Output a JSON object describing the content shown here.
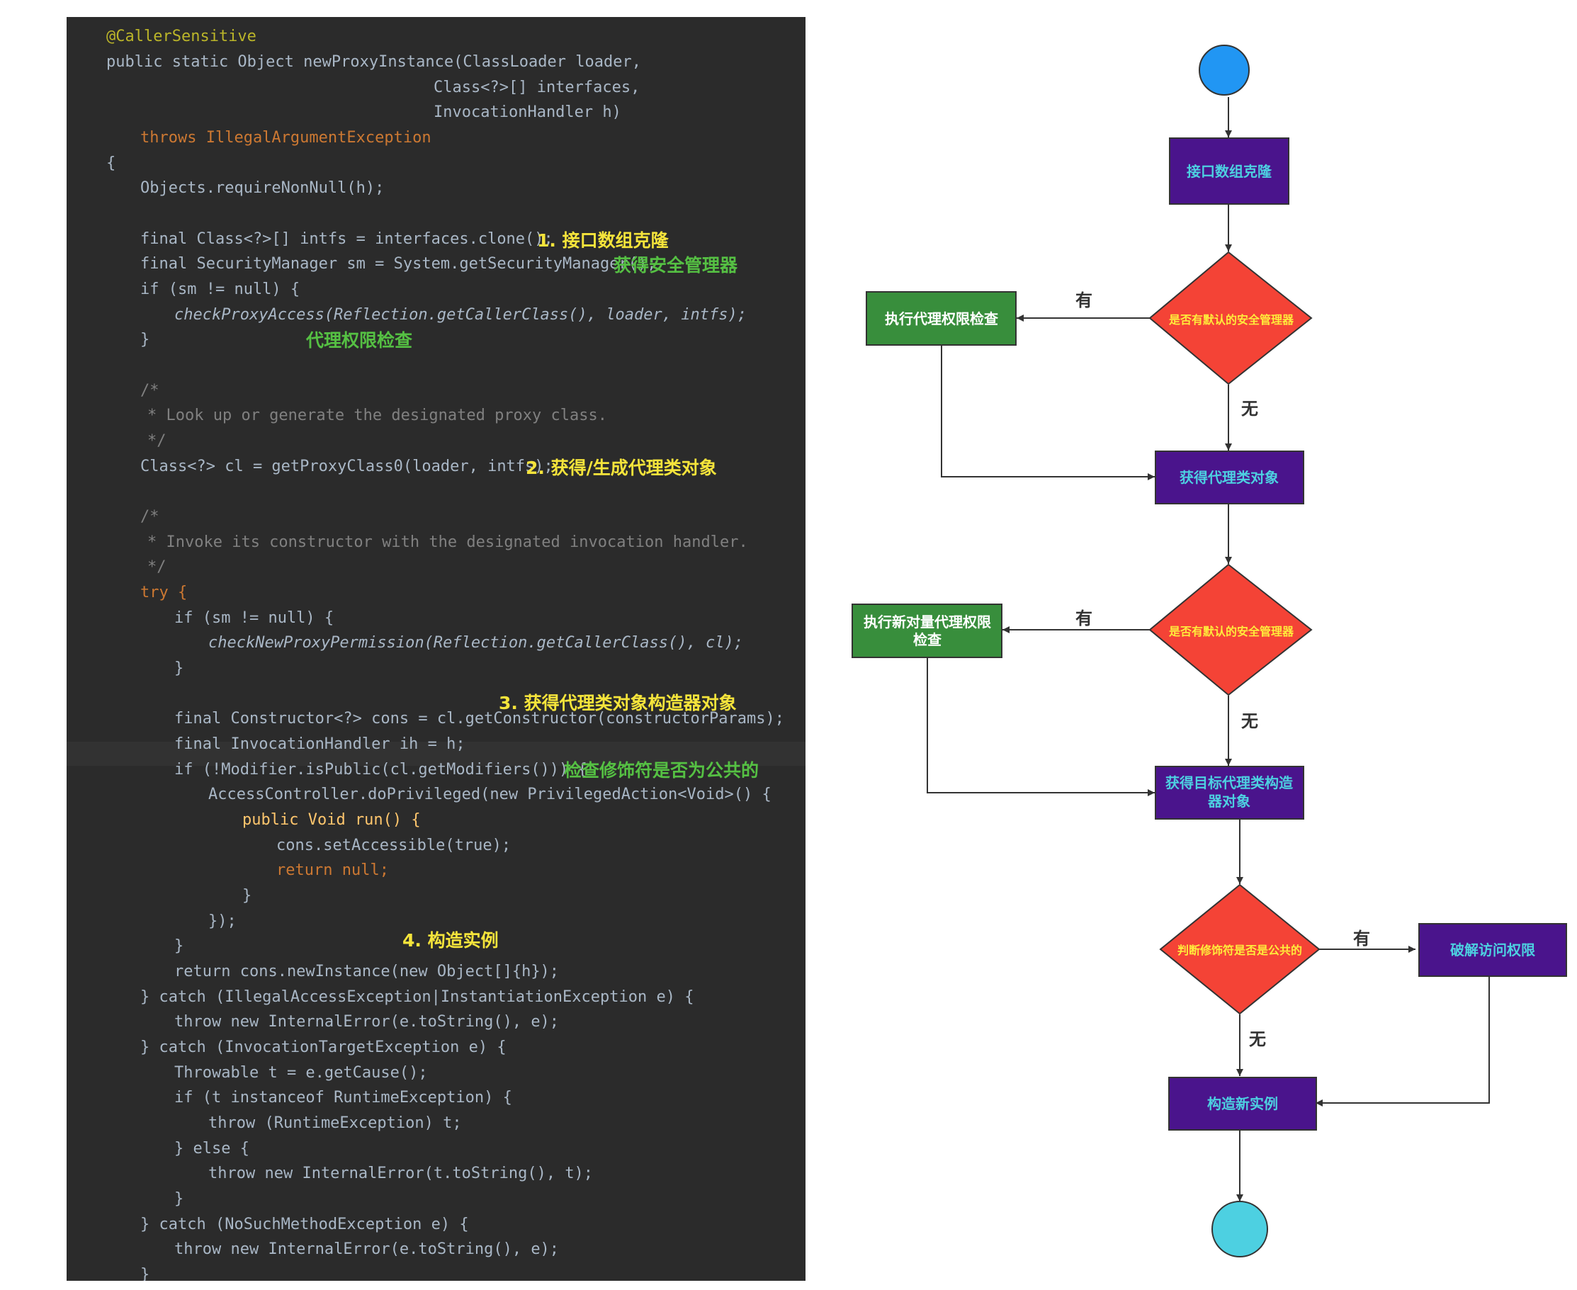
{
  "code": {
    "lines": [
      "@CallerSensitive",
      "public static Object newProxyInstance(ClassLoader loader,",
      "Class<?>[] interfaces,",
      "InvocationHandler h)",
      "throws IllegalArgumentException",
      "{",
      "Objects.requireNonNull(h);",
      "final Class<?>[] intfs = interfaces.clone();",
      "final SecurityManager sm = System.getSecurityManager();",
      "if (sm != null) {",
      "checkProxyAccess(Reflection.getCallerClass(), loader, intfs);",
      "}",
      "/*",
      "* Look up or generate the designated proxy class.",
      "*/",
      "Class<?> cl = getProxyClass0(loader, intfs);",
      "/*",
      "* Invoke its constructor with the designated invocation handler.",
      "*/",
      "try {",
      "if (sm != null) {",
      "checkNewProxyPermission(Reflection.getCallerClass(), cl);",
      "}",
      "final Constructor<?> cons = cl.getConstructor(constructorParams);",
      "final InvocationHandler ih = h;",
      "if (!Modifier.isPublic(cl.getModifiers())) {",
      "AccessController.doPrivileged(new PrivilegedAction<Void>() {",
      "public Void run() {",
      "cons.setAccessible(true);",
      "return null;",
      "}",
      "});",
      "}",
      "return cons.newInstance(new Object[]{h});",
      "} catch (IllegalAccessException|InstantiationException e) {",
      "throw new InternalError(e.toString(), e);",
      "} catch (InvocationTargetException e) {",
      "Throwable t = e.getCause();",
      "if (t instanceof RuntimeException) {",
      "throw (RuntimeException) t;",
      "} else {",
      "throw new InternalError(t.toString(), t);",
      "}",
      "} catch (NoSuchMethodException e) {",
      "throw new InternalError(e.toString(), e);",
      "}"
    ],
    "annotations": {
      "a1": "1. 接口数组克隆",
      "a2": "获得安全管理器",
      "a3": "代理权限检查",
      "a4": "2. 获得/生成代理类对象",
      "a5": "3. 获得代理类对象构造器对象",
      "a6": "检查修饰符是否为公共的",
      "a7": "4. 构造实例"
    }
  },
  "flow": {
    "nodes": {
      "clone": "接口数组克隆",
      "check_sm1": "是否有默认的安全管理器",
      "proxy_access": "执行代理权限检查",
      "get_proxy_class": "获得代理类对象",
      "check_sm2": "是否有默认的安全管理器",
      "new_proxy_perm_1": "执行新对量代理权限",
      "new_proxy_perm_2": "检查",
      "get_ctor_1": "获得目标代理类构造",
      "get_ctor_2": "器对象",
      "check_public": "判断修饰符是否是公共的",
      "crack_access": "破解访问权限",
      "new_instance": "构造新实例"
    },
    "edge_labels": {
      "yes1": "有",
      "no1": "无",
      "yes2": "有",
      "no2": "无",
      "yes3": "有",
      "no3": "无"
    },
    "colors": {
      "process": "#4a148c",
      "process_text": "#4dd0e1",
      "decision": "#f44336",
      "decision_text": "#ffeb3b",
      "side_action": "#388e3c",
      "start": "#2196f3",
      "end": "#4dd0e1"
    }
  }
}
